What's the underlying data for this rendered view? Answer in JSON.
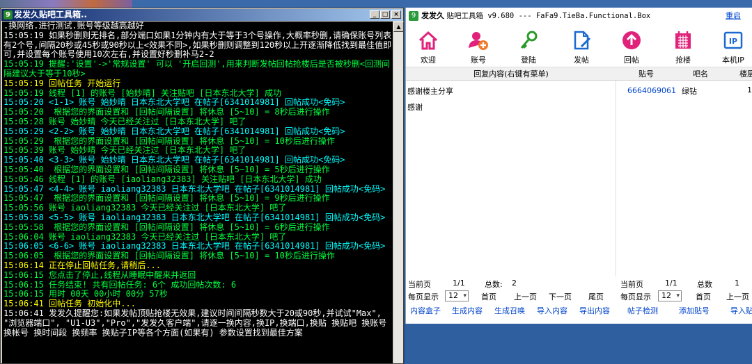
{
  "console_window": {
    "title": "发发久贴吧工具箱..",
    "lines": [
      {
        "t": ".换网络.进行测试.账号等级越高越好",
        "c": "w"
      },
      {
        "t": "15:05:19 如果秒删则无排名,部分端口如果1分钟内有大于等于3个号操作,大概率秒删,请确保账号列表有2个号,间隔20秒或45秒或90秒以上<效果不同>,如果秒删则调整到120秒以上开逐渐降低找到最佳值即可,并设置每个账号使用10次左右,并设置好秒删补马2-2",
        "c": "w"
      },
      {
        "t": "15:05:19 提醒:'设置'->'常规设置' 可以 '开启回测',用来判断发帖回帖抢楼后是否被秒删<回测间隔建议大于等于10秒>",
        "c": "g"
      },
      {
        "t": "15:05:19 回帖任务 开始运行",
        "c": "y"
      },
      {
        "t": "15:05:19 线程 [1] 的账号 [始妙晴] 关注贴吧 [日本东北大学] 成功",
        "c": "g"
      },
      {
        "t": "15:05:20 <1-1> 账号 始妙晴 日本东北大学吧 在帖子[6341014981] 回帖成功<免码>",
        "c": "c"
      },
      {
        "t": "15:05:20  根据您的界面设置和 [回帖间隔设置] 将休息 [5~10] = 8秒后进行操作",
        "c": "g"
      },
      {
        "t": "15:05:28 账号 始妙晴 今天已经关注过 [日本东北大学] 吧了",
        "c": "g"
      },
      {
        "t": "15:05:29 <2-2> 账号 始妙晴 日本东北大学吧 在帖子[6341014981] 回帖成功<免码>",
        "c": "c"
      },
      {
        "t": "15:05:29  根据您的界面设置和 [回帖间隔设置] 将休息 [5~10] = 10秒后进行操作",
        "c": "g"
      },
      {
        "t": "15:05:39 账号 始妙晴 今天已经关注过 [日本东北大学] 吧了",
        "c": "g"
      },
      {
        "t": "15:05:40 <3-3> 账号 始妙晴 日本东北大学吧 在帖子[6341014981] 回帖成功<免码>",
        "c": "c"
      },
      {
        "t": "15:05:40  根据您的界面设置和 [回帖间隔设置] 将休息 [5~10] = 5秒后进行操作",
        "c": "g"
      },
      {
        "t": "15:05:46 线程 [1] 的账号 [iaoliang32383] 关注贴吧 [日本东北大学] 成功",
        "c": "g"
      },
      {
        "t": "15:05:47 <4-4> 账号 iaoliang32383 日本东北大学吧 在帖子[6341014981] 回帖成功<免码>",
        "c": "c"
      },
      {
        "t": "15:05:47  根据您的界面设置和 [回帖间隔设置] 将休息 [5~10] = 9秒后进行操作",
        "c": "g"
      },
      {
        "t": "15:05:56 账号 iaoliang32383 今天已经关注过 [日本东北大学] 吧了",
        "c": "g"
      },
      {
        "t": "15:05:58 <5-5> 账号 iaoliang32383 日本东北大学吧 在帖子[6341014981] 回帖成功<免码>",
        "c": "c"
      },
      {
        "t": "15:05:58  根据您的界面设置和 [回帖间隔设置] 将休息 [5~10] = 6秒后进行操作",
        "c": "g"
      },
      {
        "t": "15:06:04 账号 iaoliang32383 今天已经关注过 [日本东北大学] 吧了",
        "c": "g"
      },
      {
        "t": "15:06:05 <6-6> 账号 iaoliang32383 日本东北大学吧 在帖子[6341014981] 回帖成功<免码>",
        "c": "c"
      },
      {
        "t": "15:06:05  根据您的界面设置和 [回帖间隔设置] 将休息 [5~10] = 10秒后进行操作",
        "c": "g"
      },
      {
        "t": "15:06:14 正在停止回帖任务,请稍后...",
        "c": "y"
      },
      {
        "t": "15:06:15 您点击了停止,线程从睡眠中醒来并返回",
        "c": "g"
      },
      {
        "t": "15:06:15 任务结束! 共有回帖任务: 6个 成功回帖次数: 6",
        "c": "g"
      },
      {
        "t": "15:06:15 用时 00天 00小时 00分 57秒",
        "c": "g"
      },
      {
        "t": "15:06:41 回帖任务 初始化中...",
        "c": "y"
      },
      {
        "t": "15:06:41 发发久提醒您:如果发帖顶贴抢楼无效果,建议时间间隔秒数大于20或90秒,并试试\"Max\", \"浏览器端口\", \"U1-U3\",\"Pro\",\"发发久客户端\",请逐一换内容,换IP,换端口,换贴 换贴吧 换账号 换帐号 换时间段 换频率 换贴子IP等各个方面(如果有) 参数设置找到最佳方案",
        "c": "w"
      }
    ]
  },
  "app": {
    "title_name": "发发久",
    "title_rest": "贴吧工具箱 v9.680 --- FaFa9.TieBa.Functional.Box",
    "restart_label": "重启",
    "toolbar": [
      {
        "label": "欢迎",
        "icon": "home-icon"
      },
      {
        "label": "账号",
        "icon": "add-user-icon"
      },
      {
        "label": "登陆",
        "icon": "key-icon"
      },
      {
        "label": "发帖",
        "icon": "edit-document-icon"
      },
      {
        "label": "回帖",
        "icon": "reply-arrow-icon"
      },
      {
        "label": "抢楼",
        "icon": "calendar-icon"
      },
      {
        "label": "本机IP",
        "icon": "ip-icon"
      }
    ],
    "columns": {
      "reply": "回复内容(右键有菜单)",
      "account": "贴号",
      "bar": "吧名",
      "floor": "楼层"
    },
    "reply_rows": [
      "感谢楼主分享",
      "感谢"
    ],
    "account_rows": [
      {
        "account": "6664069061",
        "bar": "绿钻",
        "floor": "1"
      }
    ],
    "left_pager": {
      "current_label": "当前页",
      "current_value": "1/1",
      "total_label": "总数:",
      "total_value": "2",
      "per_page_label": "每页显示",
      "per_page_value": "12",
      "first": "首页",
      "prev": "上一页",
      "next": "下一页",
      "last": "尾页"
    },
    "right_pager": {
      "current_label": "当前页",
      "current_value": "1/1",
      "total_label": "总数",
      "total_value": "1",
      "per_page_label": "每页显示",
      "per_page_value": "12",
      "first": "首页",
      "prev": "上一页"
    },
    "left_actions": [
      "内容盒子",
      "生成内容",
      "生成召唤",
      "导入内容",
      "导出内容"
    ],
    "right_actions": [
      "帖子检测",
      "添加贴号",
      "导入贴号"
    ]
  },
  "colors": {
    "accent": "#0a246a",
    "link": "#0044cc",
    "icon_pink": "#e0227a"
  }
}
